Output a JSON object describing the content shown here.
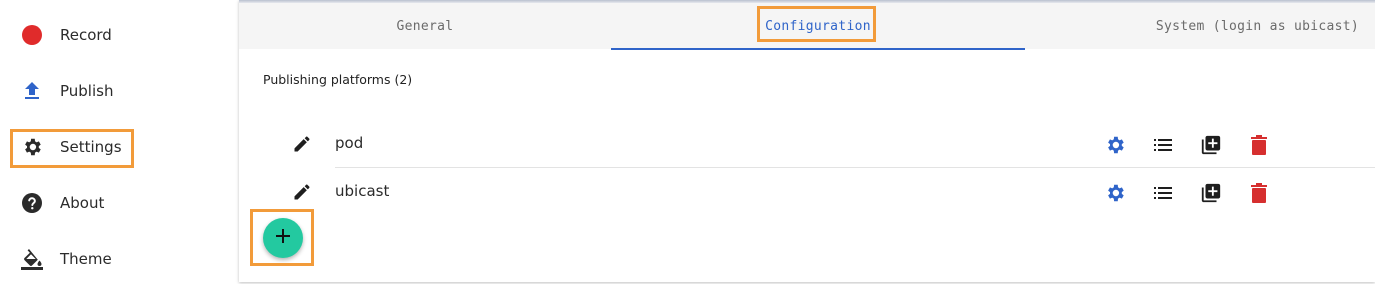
{
  "sidebar": {
    "items": [
      {
        "label": "Record",
        "icon": "record-icon"
      },
      {
        "label": "Publish",
        "icon": "upload-icon"
      },
      {
        "label": "Settings",
        "icon": "gear-icon"
      },
      {
        "label": "About",
        "icon": "help-icon"
      },
      {
        "label": "Theme",
        "icon": "paint-bucket-icon"
      }
    ]
  },
  "tabs": [
    {
      "label": "General"
    },
    {
      "label": "Configuration",
      "active": true
    },
    {
      "label": "System (login as ubicast)"
    }
  ],
  "section": {
    "title": "Publishing platforms (2)"
  },
  "platforms": [
    {
      "name": "pod"
    },
    {
      "name": "ubicast"
    }
  ],
  "add_button": {
    "icon": "plus-icon"
  },
  "colors": {
    "accent": "#2f64c9",
    "record": "#e02b2b",
    "delete": "#d62f2f",
    "fab": "#23c9a0",
    "highlight": "#f29b3a"
  }
}
